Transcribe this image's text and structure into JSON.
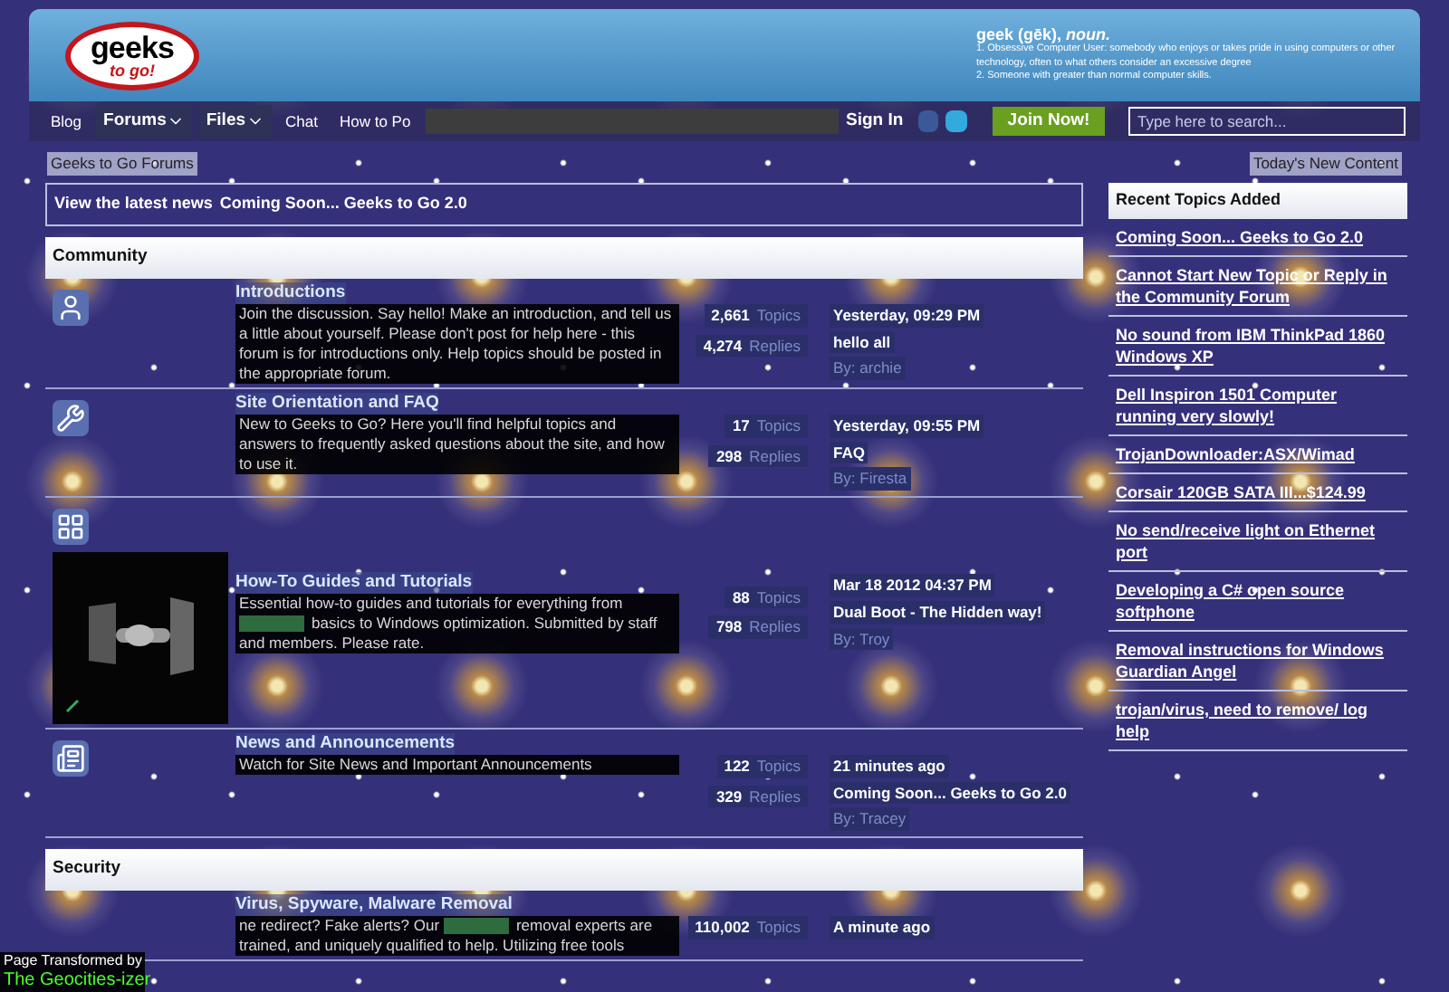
{
  "header": {
    "logo": {
      "line1": "geeks",
      "line2": "to go!"
    },
    "definition": {
      "headword": "geek (gēk), *noun.*",
      "senses": [
        "1. Obsessive Computer User: somebody who enjoys or takes pride in using computers or other technology, often to what others consider an excessive degree",
        "2. Someone with greater than normal computer skills."
      ]
    }
  },
  "nav": {
    "items": [
      {
        "label": "Blog",
        "kind": "link"
      },
      {
        "label": "Forums",
        "kind": "dropdown"
      },
      {
        "label": "Files",
        "kind": "dropdown"
      },
      {
        "label": "Chat",
        "kind": "link"
      },
      {
        "label": "How to Po",
        "kind": "link"
      }
    ],
    "sign_in": "Sign In",
    "join": "Join Now!",
    "search": {
      "placeholder": "Type here to search..."
    }
  },
  "breadcrumb": {
    "location": "Geeks to Go Forums",
    "new_content": "Today's New Content"
  },
  "news": {
    "label": "View the latest news",
    "link": "Coming Soon... Geeks to Go 2.0"
  },
  "categories": [
    {
      "title": "Community",
      "forums": [
        {
          "title": "Introductions",
          "description": [
            {
              "kind": "text",
              "text": "Join the discussion. Say hello! Make an introduction, and tell us a little about yourself. Please don't post for help here - this forum is for introductions only. Help topics should be posted in the appropriate forum."
            }
          ],
          "topics": "2,661",
          "topics_label": "Topics",
          "replies": "4,274",
          "replies_label": "Replies",
          "last": {
            "date": "Yesterday, 09:29 PM",
            "title": "hello all",
            "by": "By: archie"
          }
        },
        {
          "title": "Site Orientation and FAQ",
          "description": [
            {
              "kind": "text",
              "text": "New to Geeks to Go? Here you'll find helpful topics and answers to frequently asked questions about the site, and how to use it."
            }
          ],
          "topics": "17",
          "topics_label": "Topics",
          "replies": "298",
          "replies_label": "Replies",
          "last": {
            "date": "Yesterday, 09:55 PM",
            "title": "FAQ",
            "by": "By: Firesta"
          }
        },
        {
          "image": {
            "kind": "picture"
          },
          "title": "How-To Guides and Tutorials",
          "description": [
            {
              "kind": "text",
              "text": "Essential how-to guides and tutorials for everything from"
            },
            {
              "kind": "redacted"
            },
            {
              "kind": "text",
              "text": "basics to Windows optimization. Submitted by staff and members. Please rate."
            }
          ],
          "topics": "88",
          "topics_label": "Topics",
          "replies": "798",
          "replies_label": "Replies",
          "last": {
            "date": "Mar 18 2012 04:37 PM",
            "title": "Dual Boot - The Hidden way!",
            "by": "By: Troy"
          }
        },
        {
          "title": "News and Announcements",
          "description": [
            {
              "kind": "text",
              "text": "Watch for Site News and Important Announcements"
            }
          ],
          "topics": "122",
          "topics_label": "Topics",
          "replies": "329",
          "replies_label": "Replies",
          "last": {
            "date": "21 minutes ago",
            "title": "Coming Soon... Geeks to Go 2.0",
            "by": "By: Tracey"
          }
        }
      ]
    },
    {
      "title": "Security",
      "forums": [
        {
          "title": "Virus, Spyware, Malware Removal",
          "description": [
            {
              "kind": "text",
              "text": "ne redirect? Fake alerts? Our"
            },
            {
              "kind": "redacted"
            },
            {
              "kind": "text",
              "text": "removal experts are trained, and uniquely qualified to help. Utilizing free tools"
            }
          ],
          "topics": "110,002",
          "topics_label": "Topics",
          "last": {
            "date": "A minute ago"
          }
        }
      ]
    }
  ],
  "sidebar": {
    "title": "Recent Topics Added",
    "topics": [
      "Coming Soon... Geeks to Go 2.0",
      "Cannot Start New Topic or Reply in the Community Forum",
      "No sound from IBM ThinkPad 1860 Windows XP",
      "Dell Inspiron 1501 Computer running very slowly!",
      "TrojanDownloader:ASX/Wimad",
      "Corsair 120GB SATA III...$124.99",
      "No send/receive light on Ethernet port",
      "Developing a C# open source softphone",
      "Removal instructions for Windows Guardian Angel",
      "trojan/virus, need to remove/ log help"
    ]
  },
  "badge": {
    "line1": "Page Transformed by",
    "line2": "The Geocities-izer"
  }
}
